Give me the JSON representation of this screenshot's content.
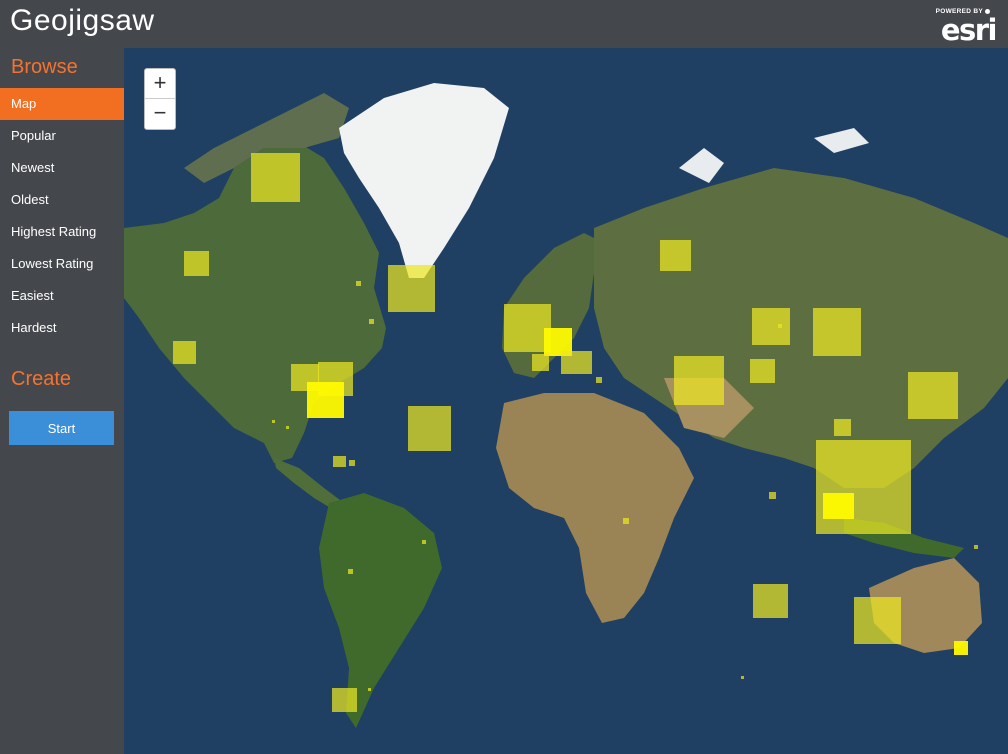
{
  "header": {
    "title": "Geojigsaw",
    "logo_powered": "POWERED BY",
    "logo_word": "esri"
  },
  "sidebar": {
    "browse_heading": "Browse",
    "items": [
      {
        "label": "Map",
        "active": true
      },
      {
        "label": "Popular",
        "active": false
      },
      {
        "label": "Newest",
        "active": false
      },
      {
        "label": "Oldest",
        "active": false
      },
      {
        "label": "Highest Rating",
        "active": false
      },
      {
        "label": "Lowest Rating",
        "active": false
      },
      {
        "label": "Easiest",
        "active": false
      },
      {
        "label": "Hardest",
        "active": false
      }
    ],
    "create_heading": "Create",
    "start_label": "Start"
  },
  "map": {
    "zoom_in": "+",
    "zoom_out": "−",
    "basemap": "satellite imagery",
    "marker_color": "#ece822",
    "highlight_color": "#fffa00",
    "puzzle_markers": 40
  },
  "colors": {
    "header_bg": "#44474c",
    "accent": "#f26f21",
    "button": "#3b8fd8"
  }
}
